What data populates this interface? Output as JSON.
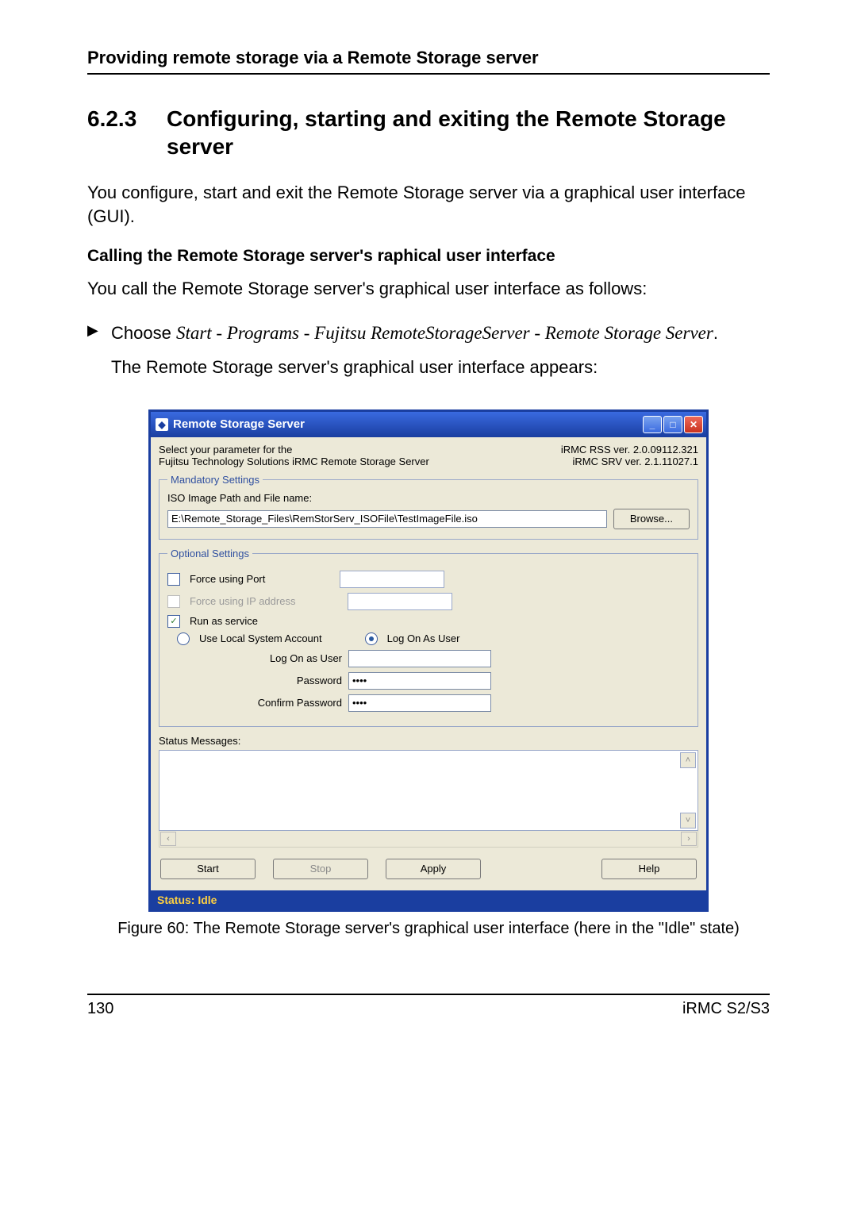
{
  "doc": {
    "running_head": "Providing remote storage via a Remote Storage server",
    "section_number": "6.2.3",
    "section_title": "Configuring, starting and exiting the Remote Storage server",
    "para1": "You configure, start and exit the Remote Storage server via a graphical user interface (GUI).",
    "subhead": "Calling the Remote Storage server's raphical user interface",
    "para2": "You call the Remote Storage server's graphical user interface as follows:",
    "bullet_mark": "▶",
    "bullet_lead": "Choose ",
    "bullet_italic": "Start - Programs - Fujitsu RemoteStorageServer - Remote Storage Server",
    "bullet_period": ".",
    "bullet_after": "The Remote Storage server's graphical user interface appears:",
    "figure_caption": "Figure 60: The Remote Storage server's graphical user interface (here in the \"Idle\" state)",
    "page_number": "130",
    "product": "iRMC S2/S3"
  },
  "dialog": {
    "title": "Remote Storage Server",
    "title_icon_glyph": "◆",
    "select_line1": "Select your parameter for the",
    "select_line2": "Fujitsu Technology Solutions iRMC Remote Storage Server",
    "ver1": "iRMC RSS ver. 2.0.09112.321",
    "ver2": "iRMC SRV ver. 2.1.11027.1",
    "mandatory_legend": "Mandatory Settings",
    "iso_label": "ISO Image Path and File name:",
    "iso_value": "E:\\Remote_Storage_Files\\RemStorServ_ISOFile\\TestImageFile.iso",
    "browse": "Browse...",
    "optional_legend": "Optional Settings",
    "force_port": "Force using Port",
    "force_ip": "Force using IP address",
    "run_as_service": "Run as service",
    "run_as_service_checked": "✓",
    "use_local": "Use Local System Account",
    "log_on_as_user_radio": "Log On As User",
    "logon_label": "Log On as User",
    "password_label": "Password",
    "confirm_label": "Confirm Password",
    "password_mask": "••••",
    "status_messages_label": "Status Messages:",
    "start_btn": "Start",
    "stop_btn": "Stop",
    "apply_btn": "Apply",
    "help_btn": "Help",
    "status_bar": "Status: Idle",
    "min_glyph": "_",
    "max_glyph": "□",
    "close_glyph": "✕",
    "scroll_up": "˄",
    "scroll_down": "˅",
    "scroll_left": "‹",
    "scroll_right": "›"
  }
}
